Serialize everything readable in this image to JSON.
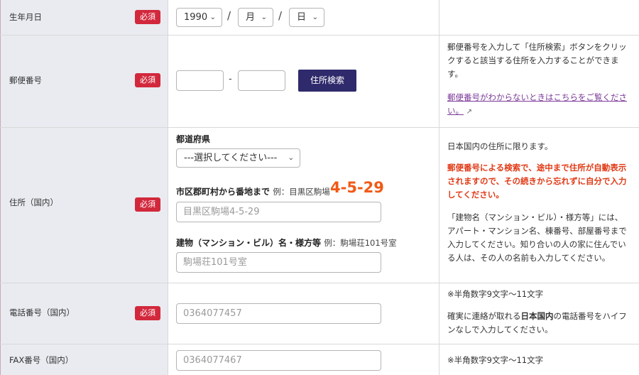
{
  "required_label": "必須",
  "birthdate": {
    "label": "生年月日",
    "year": "1990",
    "month": "月",
    "day": "日",
    "separator": "/"
  },
  "postal": {
    "label": "郵便番号",
    "dash": "-",
    "search_button": "住所検索",
    "note": "郵便番号を入力して「住所検索」ボタンをクリックすると該当する住所を入力することができます。",
    "link": "郵便番号がわからないときはこちらをご覧ください。"
  },
  "address": {
    "label": "住所（国内）",
    "prefecture_label": "都道府県",
    "prefecture_select": "---選択してください---",
    "city_label": "市区郡町村から番地まで",
    "city_example": "例：目黒区駒場",
    "city_example_number": "4-5-29",
    "city_placeholder": "目黒区駒場4-5-29",
    "building_label": "建物（マンション・ビル）名・様方等",
    "building_example": "例：駒場荘101号室",
    "building_placeholder": "駒場荘101号室",
    "note_1": "日本国内の住所に限ります。",
    "note_2_red": "郵便番号による検索で、途中まで住所が自動表示されますので、その続きから忘れずに自分で入力してください。",
    "note_3": "「建物名（マンション・ビル）・様方等」には、アパート・マンション名、棟番号、部屋番号まで入力してください。知り合いの人の家に住んでいる人は、その人の名前も入力してください。"
  },
  "phone": {
    "label": "電話番号（国内）",
    "placeholder": "0364077457",
    "note_1": "※半角数字9文字〜11文字",
    "note_2_prefix": "確実に連絡が取れる",
    "note_2_bold": "日本国内",
    "note_2_suffix": "の電話番号をハイフンなしで入力してください。"
  },
  "fax": {
    "label": "FAX番号（国内）",
    "placeholder": "0364077467",
    "note": "※半角数字9文字〜11文字"
  }
}
